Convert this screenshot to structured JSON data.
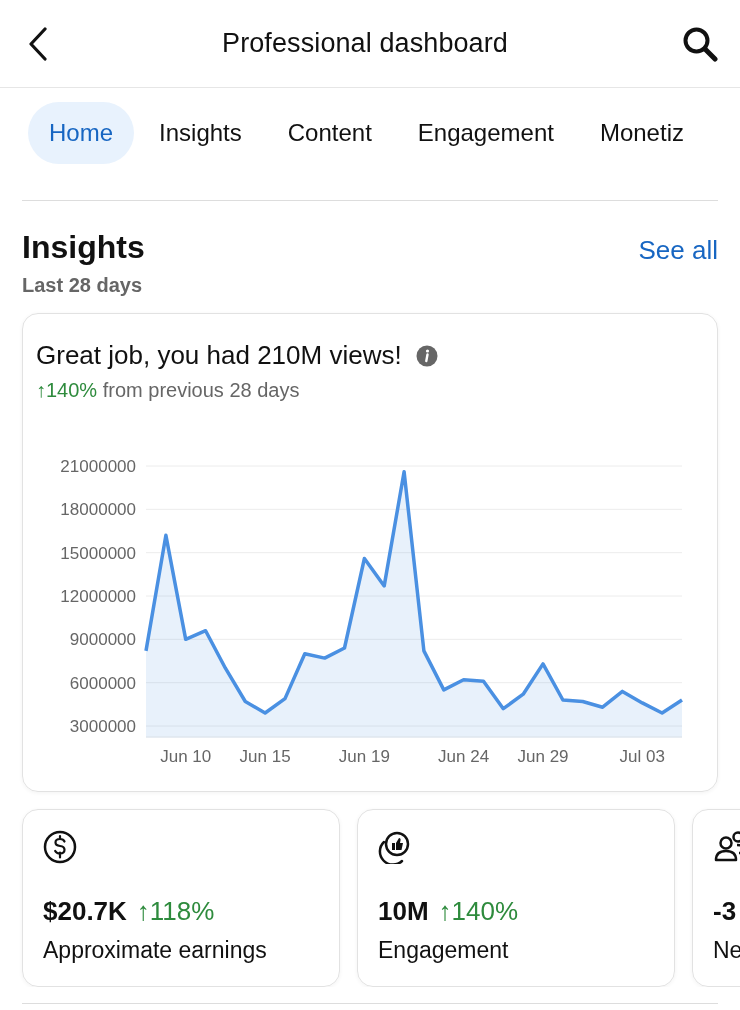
{
  "header": {
    "title": "Professional dashboard"
  },
  "tabs": [
    {
      "label": "Home",
      "selected": true
    },
    {
      "label": "Insights",
      "selected": false
    },
    {
      "label": "Content",
      "selected": false
    },
    {
      "label": "Engagement",
      "selected": false
    },
    {
      "label": "Monetiz",
      "selected": false
    }
  ],
  "insights": {
    "title": "Insights",
    "link": "See all",
    "subtitle": "Last 28 days",
    "card": {
      "headline": "Great job, you had 210M views!",
      "change": "↑140%",
      "change_text": "from previous 28 days",
      "chart_data": {
        "type": "area",
        "grid": true,
        "categories": [
          null,
          null,
          "Jun 10",
          null,
          null,
          null,
          "Jun 15",
          null,
          null,
          null,
          null,
          "Jun 19",
          null,
          null,
          null,
          null,
          "Jun 24",
          null,
          null,
          null,
          "Jun 29",
          null,
          null,
          null,
          null,
          "Jul 03",
          null,
          null
        ],
        "series": [
          {
            "color": "#4a90e2",
            "values": [
              8200000,
              16200000,
              9000000,
              9600000,
              7000000,
              4700000,
              3900000,
              4900000,
              8000000,
              7700000,
              8400000,
              14600000,
              12700000,
              20600000,
              8200000,
              5500000,
              6200000,
              6100000,
              4200000,
              5200000,
              7300000,
              4800000,
              4700000,
              4300000,
              5400000,
              4600000,
              3900000,
              4800000
            ]
          }
        ],
        "ylim": [
          2240000,
          21000000
        ],
        "yticks": [
          {
            "value": 3000000,
            "label": "3000000"
          },
          {
            "value": 6000000,
            "label": "6000000"
          },
          {
            "value": 9000000,
            "label": "9000000"
          },
          {
            "value": 12000000,
            "label": "12000000"
          },
          {
            "value": 15000000,
            "label": "15000000"
          },
          {
            "value": 18000000,
            "label": "18000000"
          },
          {
            "value": 21000000,
            "label": "21000000"
          }
        ]
      }
    }
  },
  "metrics": [
    {
      "kind": "earnings",
      "value": "$20.7K",
      "change": "↑118%",
      "label": "Approximate earnings"
    },
    {
      "kind": "engagement",
      "value": "10M",
      "change": "↑140%",
      "label": "Engagement"
    },
    {
      "kind": "followers",
      "value": "-3",
      "label": "Ne"
    }
  ]
}
